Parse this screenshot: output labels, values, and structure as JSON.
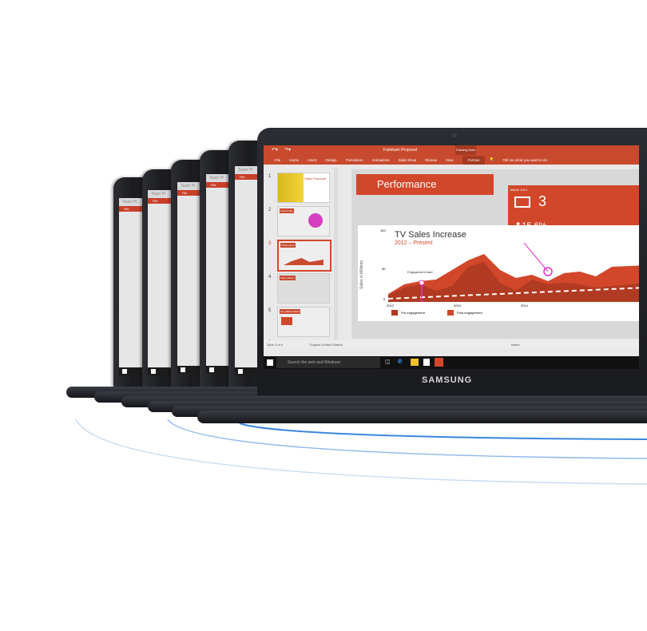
{
  "window": {
    "title": "Fabrikam Proposal",
    "contextual_tab": "Drawing tools",
    "tabs": [
      "File",
      "Home",
      "Insert",
      "Design",
      "Transitions",
      "Animations",
      "Slide Show",
      "Review",
      "View",
      "Format"
    ],
    "tell_me": "Tell me what you want to do"
  },
  "background_laptops": {
    "title_snippet": "Team Pl",
    "file_tab": "File",
    "status": "Slide 3 of 9"
  },
  "thumbnails": [
    {
      "num": "1",
      "caption": "Sales Proposal"
    },
    {
      "num": "2",
      "caption": "Opportunity"
    },
    {
      "num": "3",
      "caption": "Performance"
    },
    {
      "num": "4",
      "caption": "Sales History"
    },
    {
      "num": "5",
      "caption": "Key differentiators"
    },
    {
      "num": "6",
      "caption": ""
    }
  ],
  "slide": {
    "heading": "Performance",
    "card": {
      "month": "March 2014",
      "value": "3",
      "change": "15.6%"
    },
    "chart_title": "TV Sales Increase",
    "chart_subtitle": "2012 – Present",
    "y_label": "Sales in Millions",
    "y_ticks": [
      "100",
      "50",
      "0"
    ],
    "x_ticks": [
      "2012",
      "2013",
      "2014"
    ],
    "annotation": "Engagement start",
    "legend": [
      "Pre-engagement",
      "Post-engagement"
    ]
  },
  "statusbar": {
    "slide_of": "Slide 3 of 9",
    "language": "English (United States)",
    "notes": "Notes"
  },
  "taskbar": {
    "search_placeholder": "Search the web and Windows"
  },
  "brand": "SAMSUNG",
  "colors": {
    "accent": "#c84a2e",
    "wave": "#3a86e0"
  }
}
